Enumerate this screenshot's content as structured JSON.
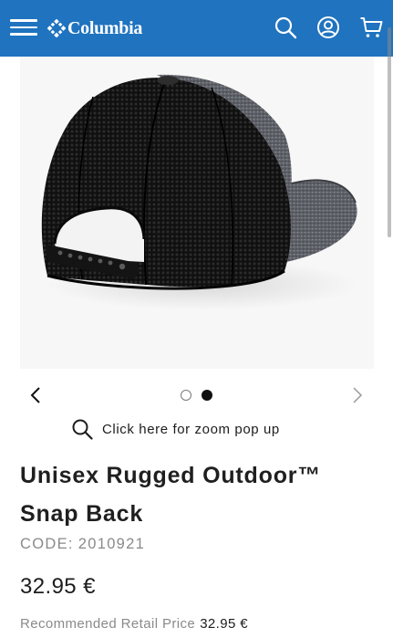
{
  "header": {
    "brand": "Columbia",
    "background_color": "#1f73bf",
    "icons": [
      "menu-icon",
      "search-icon",
      "account-icon",
      "cart-icon"
    ]
  },
  "gallery": {
    "image_alt": "Black mesh back of grey trucker snap back cap",
    "total_images": 2,
    "active_index": 2
  },
  "zoom": {
    "label": "Click here for zoom pop up"
  },
  "product": {
    "title_line1": "Unisex Rugged Outdoor™",
    "title_line2": "Snap Back",
    "code_label": "CODE:",
    "code_value": "2010921",
    "price": "32.95 €",
    "rrp_label": "Recommended Retail Price",
    "rrp_value": "32.95 €"
  }
}
